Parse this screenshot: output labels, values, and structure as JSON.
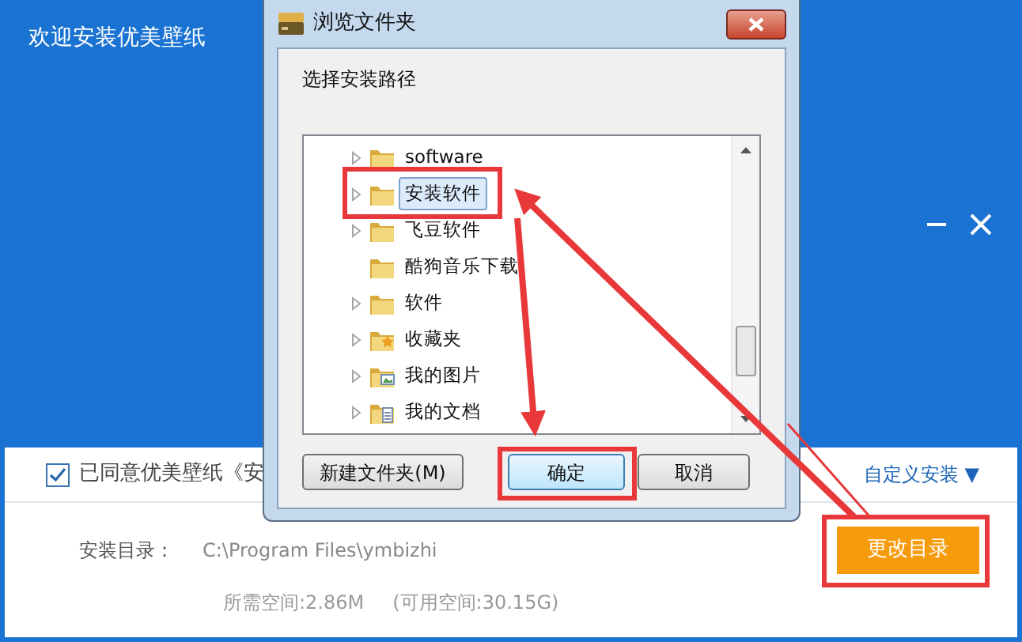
{
  "window": {
    "title": "欢迎安装优美壁纸"
  },
  "agreement": {
    "checked": true,
    "text": "已同意优美壁纸《安"
  },
  "custom_install": {
    "label": "自定义安装",
    "arrow": "▼"
  },
  "install_dir": {
    "label": "安装目录：",
    "path": "C:\\Program Files\\ymbizhi",
    "button": "更改目录"
  },
  "space": {
    "required": "所需空间:2.86M",
    "available": "(可用空间:30.15G)"
  },
  "dialog": {
    "title": "浏览文件夹",
    "prompt": "选择安装路径",
    "tree": [
      {
        "label": "software",
        "kind": "folder",
        "expandable": true,
        "selected": false
      },
      {
        "label": "安装软件",
        "kind": "folder",
        "expandable": true,
        "selected": true
      },
      {
        "label": "飞豆软件",
        "kind": "folder",
        "expandable": true,
        "selected": false
      },
      {
        "label": "酷狗音乐下载",
        "kind": "folder",
        "expandable": false,
        "selected": false
      },
      {
        "label": "软件",
        "kind": "folder",
        "expandable": true,
        "selected": false
      },
      {
        "label": "收藏夹",
        "kind": "favorites",
        "expandable": true,
        "selected": false
      },
      {
        "label": "我的图片",
        "kind": "pictures",
        "expandable": true,
        "selected": false
      },
      {
        "label": "我的文档",
        "kind": "documents",
        "expandable": true,
        "selected": false
      }
    ],
    "buttons": [
      {
        "label": "新建文件夹(M)",
        "default": false
      },
      {
        "label": "确定",
        "default": true
      },
      {
        "label": "取消",
        "default": false
      }
    ]
  }
}
